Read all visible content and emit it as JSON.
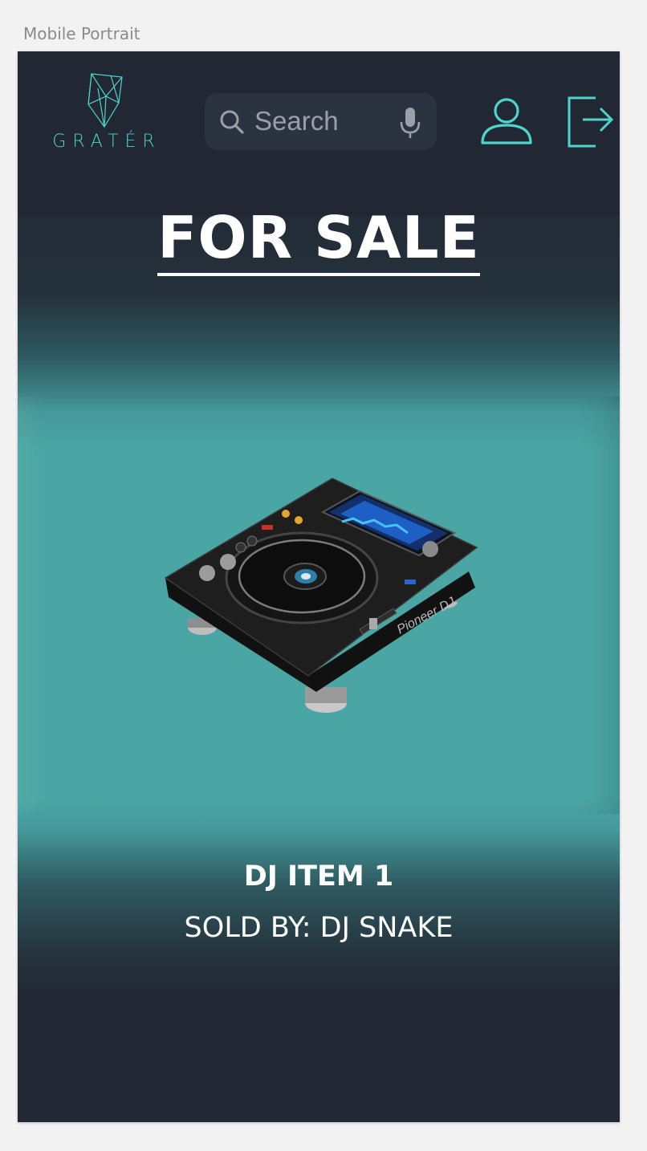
{
  "artboard": {
    "label": "Mobile Portrait"
  },
  "header": {
    "logo_text": "GRATÉR",
    "search": {
      "placeholder": "Search",
      "value": ""
    }
  },
  "page": {
    "title": "FOR SALE"
  },
  "item": {
    "name": "DJ ITEM 1",
    "seller_line": "SOLD BY: DJ SNAKE",
    "image": "dj-cdj-player"
  },
  "icons": {
    "logo": "polygon-gem-icon",
    "search": "search-icon",
    "mic": "mic-icon",
    "account": "user-icon",
    "logout": "logout-icon"
  },
  "colors": {
    "background": "#212733",
    "accent": "#4dd4cc",
    "teal_band": "#4aa6a4",
    "search_bg": "#2c3340"
  }
}
